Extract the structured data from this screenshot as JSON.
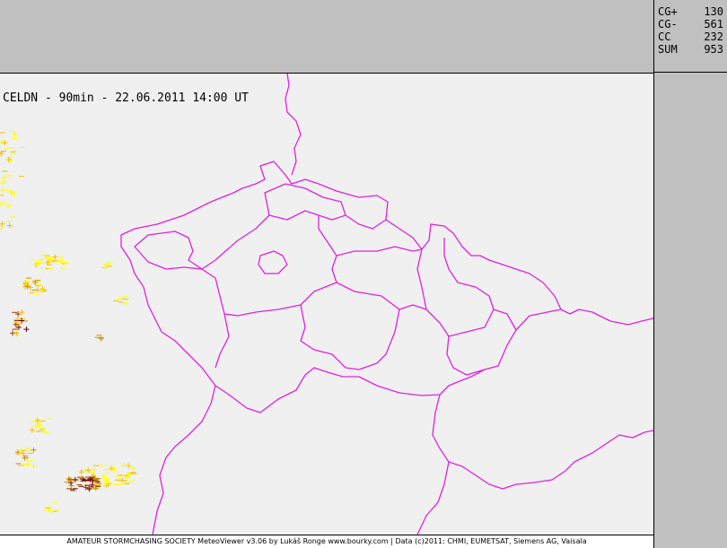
{
  "map": {
    "title": "CELDN - 90min - 22.06.2011 14:00 UT",
    "border_color": "#e020e0"
  },
  "stats": [
    {
      "label": "CG+",
      "value": "130"
    },
    {
      "label": "CG-",
      "value": "561"
    },
    {
      "label": "CC",
      "value": "232"
    },
    {
      "label": "SUM",
      "value": "953"
    }
  ],
  "footer": {
    "text": "AMATEUR STORMCHASING SOCIETY MeteoViewer v3.06 by Lukáš Ronge www.bourky.com | Data (c)2011: CHMI, EUMETSAT, Siemens AG, Vaisala"
  },
  "lightning_colors": [
    "#ffff00",
    "#f0c000",
    "#d09000",
    "#a04000",
    "#700000"
  ]
}
